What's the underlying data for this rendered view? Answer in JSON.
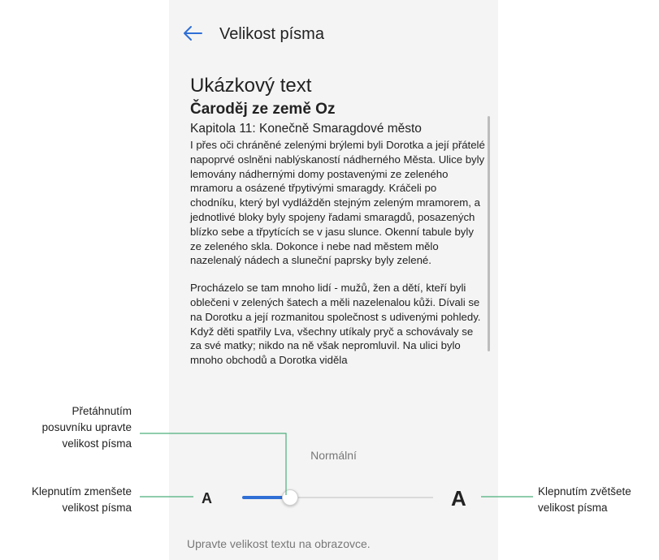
{
  "appbar": {
    "back_icon": "arrow-left-icon",
    "title": "Velikost písma"
  },
  "preview": {
    "heading": "Ukázkový text",
    "book_title": "Čaroděj ze země Oz",
    "chapter": "Kapitola 11: Konečně Smaragdové město",
    "paragraphs": [
      "I přes oči chráněné zelenými brýlemi byli Dorotka a její přátelé napoprvé oslněni nablýskaností nádherného Města. Ulice byly lemovány nádhernými domy postavenými ze zeleného mramoru a osázené třpytivými smaragdy. Kráčeli po chodníku, který byl vydlážděn stejným zeleným mramorem, a jednotlivé bloky byly spojeny řadami smaragdů, posazených blízko sebe a třpytících se v jasu slunce. Okenní tabule byly ze zeleného skla. Dokonce i nebe nad městem mělo nazelenalý nádech a sluneční paprsky byly zelené.",
      "Procházelo se tam mnoho lidí - mužů, žen a dětí, kteří byli oblečeni v zelených šatech a měli nazelenalou kůži. Dívali se na Dorotku a její rozmanitou společnost s udivenými pohledy. Když děti spatřily Lva, všechny utíkaly pryč a schovávaly se za své matky; nikdo na ně však nepromluvil. Na ulici bylo mnoho obchodů a Dorotka viděla"
    ]
  },
  "font_size": {
    "mode_label": "Normální",
    "small_label": "A",
    "large_label": "A",
    "slider_level_fraction": 0.25,
    "accent_color": "#2f6fd6"
  },
  "hint": "Upravte velikost textu na obrazovce.",
  "annotations": {
    "drag_slider": [
      "Přetáhnutím",
      "posuvníku upravte",
      "velikost písma"
    ],
    "tap_smaller": [
      "Klepnutím zmenšete",
      "velikost písma"
    ],
    "tap_larger": [
      "Klepnutím zvětšete",
      "velikost písma"
    ]
  }
}
